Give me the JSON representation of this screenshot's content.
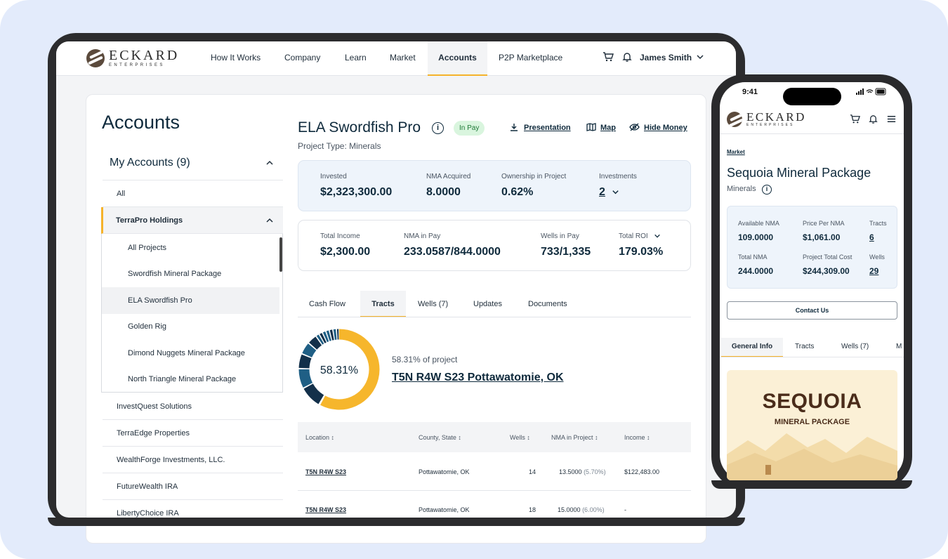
{
  "brand": {
    "name": "ECKARD",
    "sub": "ENTERPRISES"
  },
  "nav": {
    "items": [
      "How It Works",
      "Company",
      "Learn",
      "Market",
      "Accounts",
      "P2P Marketplace"
    ],
    "user": "James Smith"
  },
  "accounts": {
    "title": "Accounts",
    "my_accounts": "My Accounts (9)",
    "all": "All",
    "group": "TerraPro Holdings",
    "projects": [
      "All Projects",
      "Swordfish Mineral Package",
      "ELA Swordfish Pro",
      "Golden Rig",
      "Dimond Nuggets Mineral Package",
      "North Triangle Mineral Package"
    ],
    "others": [
      "InvestQuest Solutions",
      "TerraEdge Properties",
      "WealthForge Investments, LLC.",
      "FutureWealth IRA",
      "LibertyChoice IRA"
    ]
  },
  "project": {
    "title": "ELA Swordfish Pro",
    "status": "In Pay",
    "type": "Project Type: Minerals",
    "actions": [
      "Presentation",
      "Map",
      "Hide Money"
    ]
  },
  "stats1": [
    {
      "label": "Invested",
      "value": "$2,323,300.00"
    },
    {
      "label": "NMA Acquired",
      "value": "8.0000"
    },
    {
      "label": "Ownership in Project",
      "value": "0.62%"
    },
    {
      "label": "Investments",
      "value": "2"
    }
  ],
  "stats2": [
    {
      "label": "Total Income",
      "value": "$2,300.00"
    },
    {
      "label": "NMA in Pay",
      "value": "233.0587/844.0000"
    },
    {
      "label": "Wells in Pay",
      "value": "733/1,335"
    },
    {
      "label": "Total ROI",
      "value": "179.03%"
    }
  ],
  "tabs": [
    "Cash Flow",
    "Tracts",
    "Wells (7)",
    "Updates",
    "Documents"
  ],
  "tract": {
    "percent": 58.31,
    "percent_label": "58.31%",
    "of_project": "58.31% of project",
    "name": "T5N R4W S23 Pottawatomie, OK"
  },
  "table": {
    "headers": [
      "Location",
      "County, State",
      "Wells",
      "NMA in Project",
      "Income"
    ],
    "rows": [
      {
        "location": "T5N R4W S23",
        "county": "Pottawatomie, OK",
        "wells": "14",
        "nma": "13.5000",
        "nma_pct": "(5.70%)",
        "income": "$122,483.00"
      },
      {
        "location": "T5N R4W S23",
        "county": "Pottawatomie, OK",
        "wells": "18",
        "nma": "15.0000",
        "nma_pct": "(6.00%)",
        "income": "-"
      }
    ]
  },
  "phone": {
    "time": "9:41",
    "breadcrumb": "Market",
    "title": "Sequoia Mineral Package",
    "subtitle": "Minerals",
    "stats": [
      {
        "label": "Available NMA",
        "value": "109.0000"
      },
      {
        "label": "Price Per NMA",
        "value": "$1,061.00"
      },
      {
        "label": "Tracts",
        "value": "6"
      },
      {
        "label": "Total NMA",
        "value": "244.0000"
      },
      {
        "label": "Project Total Cost",
        "value": "$244,309.00"
      },
      {
        "label": "Wells",
        "value": "29"
      }
    ],
    "contact": "Contact Us",
    "tabs": [
      "General Info",
      "Tracts",
      "Wells (7)",
      "M"
    ],
    "banner_title": "SEQUOIA",
    "banner_sub": "MINERAL PACKAGE"
  },
  "colors": {
    "accent": "#f5b32b",
    "navy": "#0f2a3c",
    "donut_fill": "#f6b62c",
    "donut_dark": "#13304a",
    "donut_mid": "#1f5f85"
  }
}
